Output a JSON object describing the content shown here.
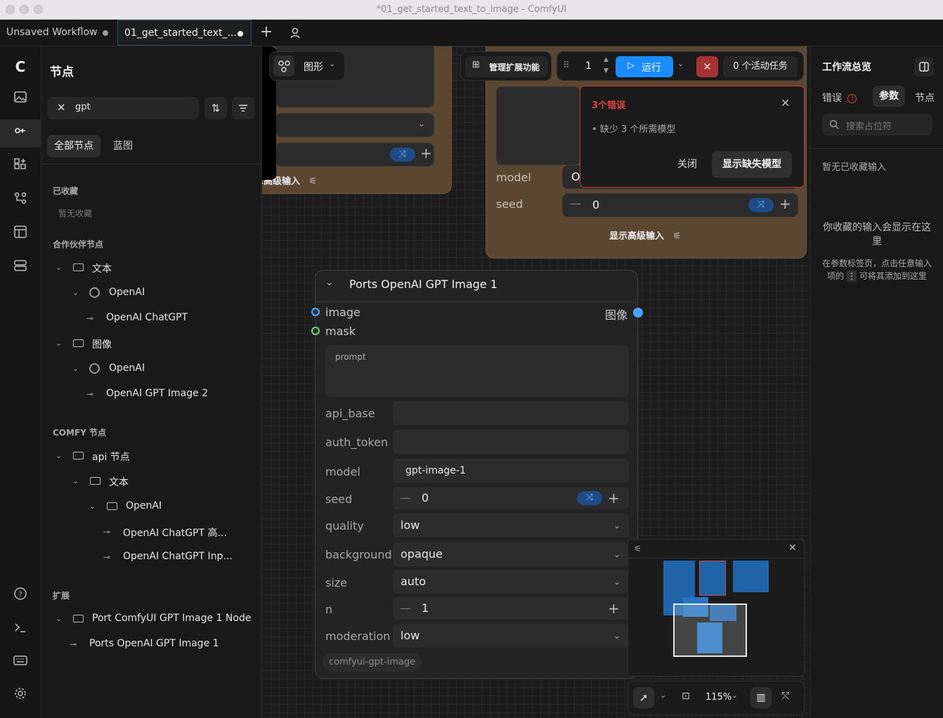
{
  "window": {
    "title": "*01_get_started_text_to_image - ComfyUI"
  },
  "tabs": [
    {
      "label": "Unsaved Workflow",
      "active": false
    },
    {
      "label": "01_get_started_text_...",
      "active": true
    }
  ],
  "left_panel": {
    "title": "节点",
    "search": {
      "value": "gpt"
    },
    "filters": [
      "全部节点",
      "蓝图"
    ],
    "favorites": {
      "header": "已收藏",
      "empty": "暂无收藏"
    },
    "partner": {
      "header": "合作伙伴节点",
      "items": [
        "文本",
        "OpenAI",
        "OpenAI ChatGPT",
        "图像",
        "OpenAI",
        "OpenAI GPT Image 2"
      ]
    },
    "comfy": {
      "header": "COMFY 节点",
      "items": [
        "api 节点",
        "文本",
        "OpenAI",
        "OpenAI ChatGPT 高...",
        "OpenAI ChatGPT Inp..."
      ]
    },
    "extensions": {
      "header": "扩展",
      "items": [
        "Port ComfyUI GPT Image 1 Node",
        "Ports OpenAI GPT Image 1"
      ]
    }
  },
  "canvas": {
    "toolbar": {
      "graph_label": "图形",
      "manage_ext": "管理扩展功能",
      "batch": "1",
      "run": "运行",
      "active_tasks": "0 个活动任务"
    },
    "left_node": {
      "adv": "示高级输入"
    },
    "right_node": {
      "model_label": "model",
      "model_value": "Opus 4.7",
      "seed_label": "seed",
      "seed_value": "0",
      "adv": "显示高级输入"
    },
    "node": {
      "title": "Ports OpenAI GPT Image 1",
      "inputs": [
        "image",
        "mask"
      ],
      "output": "图像",
      "prompt_label": "prompt",
      "widgets": {
        "api_base": {
          "label": "api_base",
          "value": ""
        },
        "auth_token": {
          "label": "auth_token",
          "value": ""
        },
        "model": {
          "label": "model",
          "value": "gpt-image-1"
        },
        "seed": {
          "label": "seed",
          "value": "0"
        },
        "quality": {
          "label": "quality",
          "value": "low"
        },
        "background": {
          "label": "background",
          "value": "opaque"
        },
        "size": {
          "label": "size",
          "value": "auto"
        },
        "n": {
          "label": "n",
          "value": "1"
        },
        "moderation": {
          "label": "moderation",
          "value": "low"
        }
      },
      "badge": "comfyui-gpt-image"
    },
    "error_popup": {
      "title": "3个错误",
      "message": "缺少 3 个所需模型",
      "close": "关闭",
      "show": "显示缺失模型"
    },
    "zoom": "115%"
  },
  "right_panel": {
    "title": "工作流总览",
    "tabs": [
      "错误",
      "参数",
      "节点"
    ],
    "search_placeholder": "搜索占位符",
    "empty_title": "暂无已收藏输入",
    "hint_title": "你收藏的输入会显示在这里",
    "hint_a": "在参数标签页，点击任意输入",
    "hint_b": "项的",
    "hint_c": "可将其添加到这里"
  },
  "colors": {
    "accent": "#1a8cff",
    "error": "#e0443e",
    "node_brown": "#5a4631"
  }
}
